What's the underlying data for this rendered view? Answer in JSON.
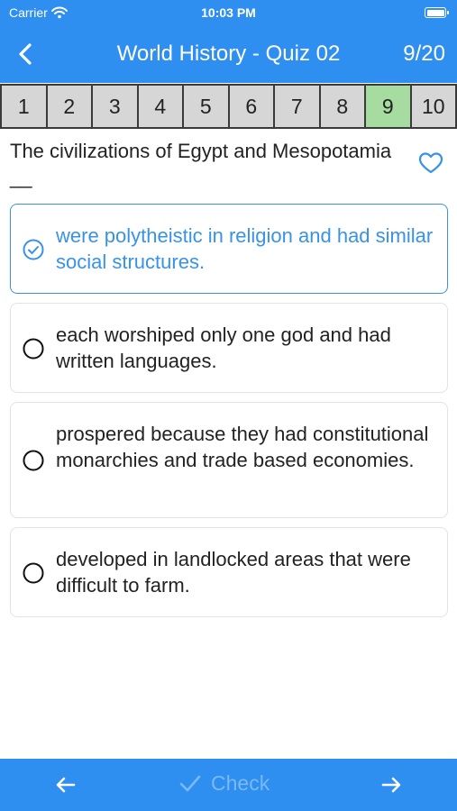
{
  "status": {
    "carrier": "Carrier",
    "time": "10:03 PM"
  },
  "header": {
    "title": "World History - Quiz 02",
    "progress": "9/20"
  },
  "question_numbers": [
    "1",
    "2",
    "3",
    "4",
    "5",
    "6",
    "7",
    "8",
    "9",
    "10"
  ],
  "current_question": "9",
  "question": {
    "text": "The civilizations of Egypt and Mesopotamia __"
  },
  "options": [
    {
      "text": "were polytheistic in religion and had similar social structures.",
      "selected": true
    },
    {
      "text": "each worshiped only one god and had written languages.",
      "selected": false
    },
    {
      "text": "prospered because they had constitutional monarchies and trade based economies.",
      "selected": false
    },
    {
      "text": "developed in landlocked areas that were difficult to farm.",
      "selected": false
    }
  ],
  "footer": {
    "check_label": "Check"
  },
  "colors": {
    "primary": "#2f8ff0",
    "selected": "#3793e8",
    "current_question": "#a6dca0",
    "check_disabled": "#79b9f5"
  }
}
